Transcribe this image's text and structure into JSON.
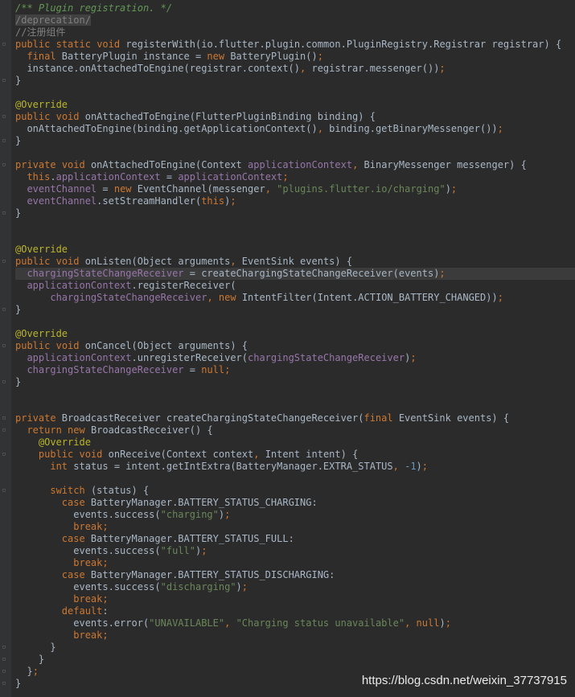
{
  "editor": {
    "lines": [
      "/** Plugin registration. */",
      "/deprecation/",
      "//注册组件",
      "public static void registerWith(io.flutter.plugin.common.PluginRegistry.Registrar registrar) {",
      "  final BatteryPlugin instance = new BatteryPlugin();",
      "  instance.onAttachedToEngine(registrar.context(), registrar.messenger());",
      "}",
      "",
      "@Override",
      "public void onAttachedToEngine(FlutterPluginBinding binding) {",
      "  onAttachedToEngine(binding.getApplicationContext(), binding.getBinaryMessenger());",
      "}",
      "",
      "private void onAttachedToEngine(Context applicationContext, BinaryMessenger messenger) {",
      "  this.applicationContext = applicationContext;",
      "  eventChannel = new EventChannel(messenger, \"plugins.flutter.io/charging\");",
      "  eventChannel.setStreamHandler(this);",
      "}",
      "",
      "",
      "@Override",
      "public void onListen(Object arguments, EventSink events) {",
      "  chargingStateChangeReceiver = createChargingStateChangeReceiver(events);",
      "  applicationContext.registerReceiver(",
      "      chargingStateChangeReceiver, new IntentFilter(Intent.ACTION_BATTERY_CHANGED));",
      "}",
      "",
      "@Override",
      "public void onCancel(Object arguments) {",
      "  applicationContext.unregisterReceiver(chargingStateChangeReceiver);",
      "  chargingStateChangeReceiver = null;",
      "}",
      "",
      "",
      "private BroadcastReceiver createChargingStateChangeReceiver(final EventSink events) {",
      "  return new BroadcastReceiver() {",
      "    @Override",
      "    public void onReceive(Context context, Intent intent) {",
      "      int status = intent.getIntExtra(BatteryManager.EXTRA_STATUS, -1);",
      "",
      "      switch (status) {",
      "        case BatteryManager.BATTERY_STATUS_CHARGING:",
      "          events.success(\"charging\");",
      "          break;",
      "        case BatteryManager.BATTERY_STATUS_FULL:",
      "          events.success(\"full\");",
      "          break;",
      "        case BatteryManager.BATTERY_STATUS_DISCHARGING:",
      "          events.success(\"discharging\");",
      "          break;",
      "        default:",
      "          events.error(\"UNAVAILABLE\", \"Charging status unavailable\", null);",
      "          break;",
      "      }",
      "    }",
      "  };",
      "}"
    ]
  },
  "watermark": "https://blog.csdn.net/weixin_37737915",
  "colors": {
    "background": "#2b2b2b",
    "keyword": "#cc7832",
    "string": "#6a8759",
    "annotation": "#bbb529",
    "field": "#9876aa",
    "comment": "#808080",
    "doc_comment": "#629755",
    "number": "#6897bb"
  }
}
